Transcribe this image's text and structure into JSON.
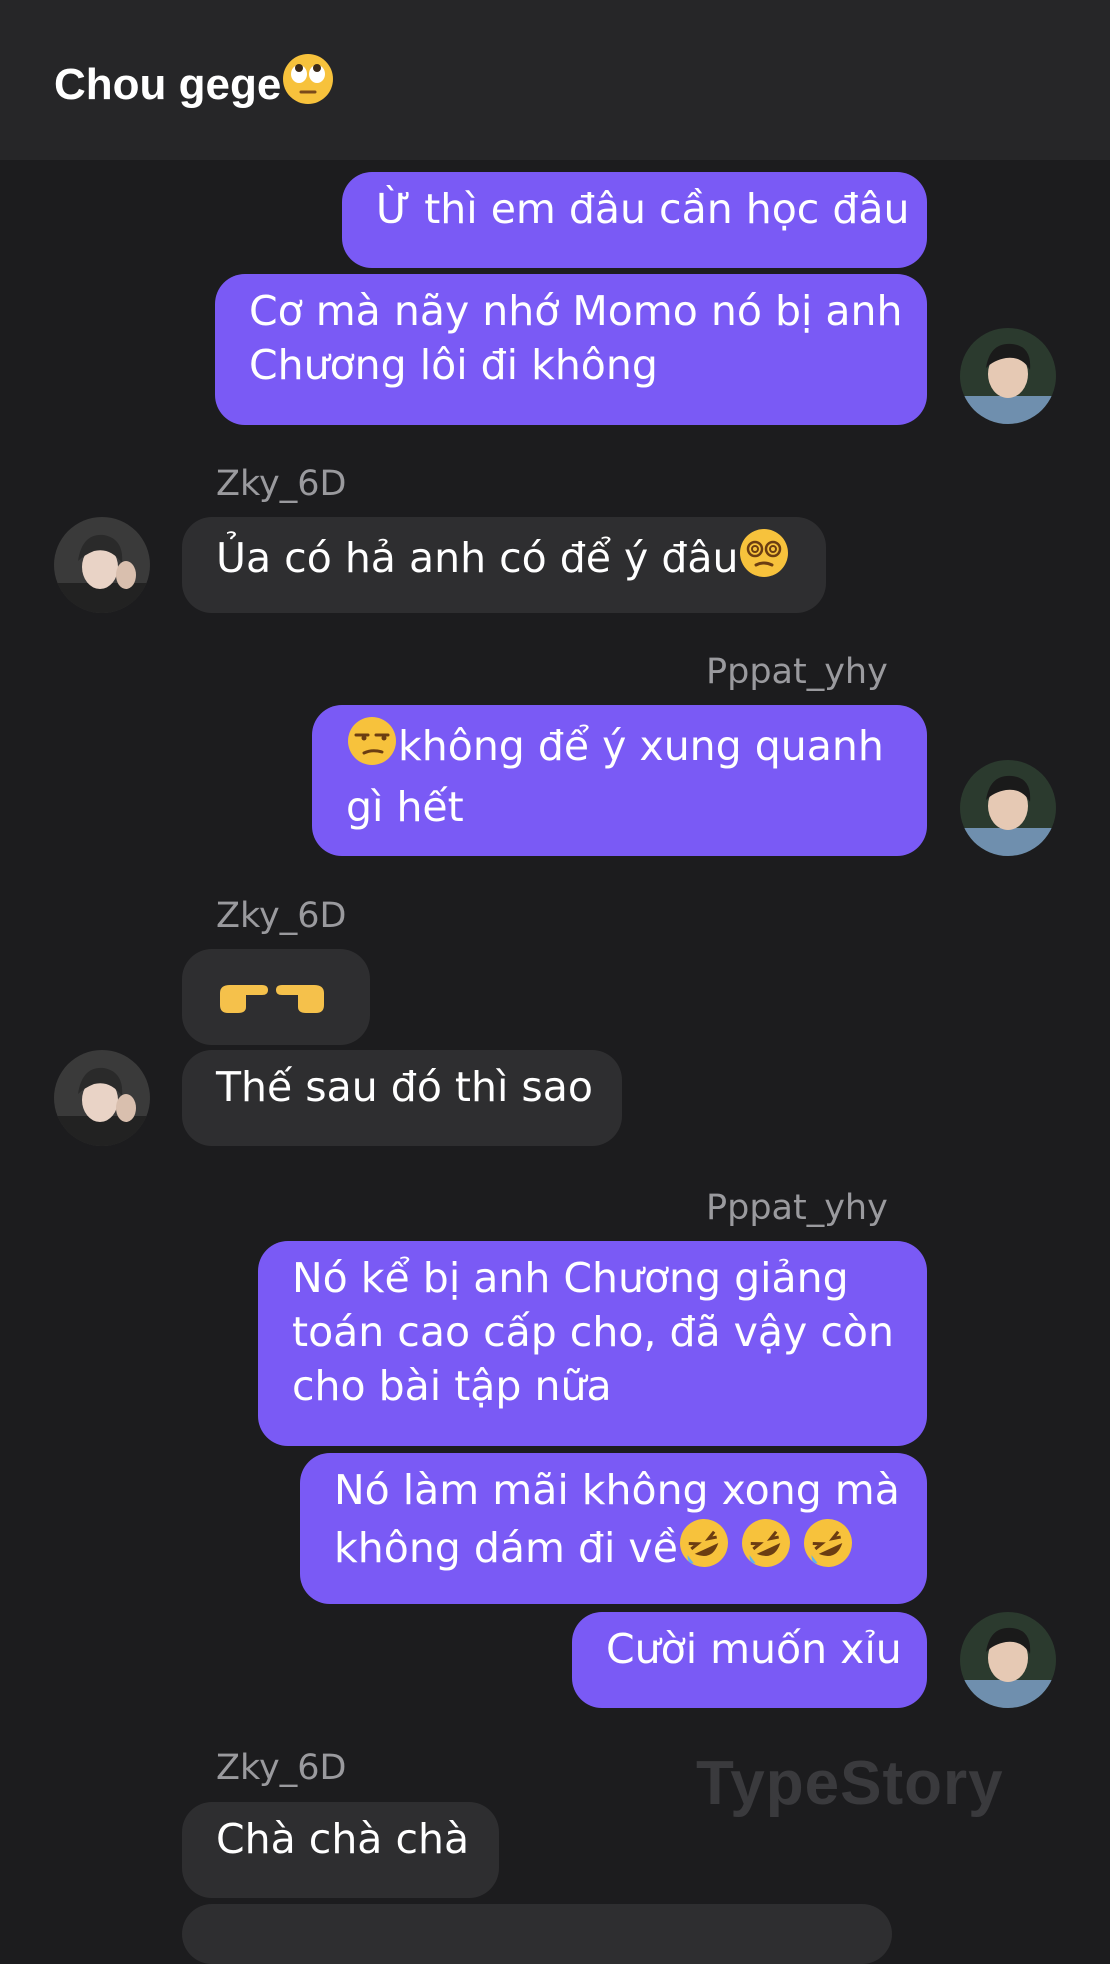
{
  "header": {
    "title": "Chou gege",
    "title_emoji": "eye-roll-emoji-icon"
  },
  "messages": [
    {
      "side": "out",
      "text": "Ừ thì em đâu cần học đâu"
    },
    {
      "side": "out",
      "lines": [
        "Cơ mà nãy nhớ Momo nó bị anh",
        "Chương lôi đi không"
      ]
    },
    {
      "side": "in",
      "sender": "Zky_6D",
      "text": "Ủa có hả anh có để ý đâu",
      "emoji": "dizzy-face-emoji-icon"
    },
    {
      "side": "out",
      "sender": "Pppat_yhy",
      "lines": [
        "không để ý xung quanh",
        "gì hết"
      ],
      "emoji": "unamused-face-emoji-icon"
    },
    {
      "side": "in",
      "sender": "Zky_6D",
      "emojis": [
        "pointing-right-emoji-icon",
        "pointing-left-emoji-icon"
      ]
    },
    {
      "side": "in",
      "text": "Thế sau đó thì sao"
    },
    {
      "side": "out",
      "sender": "Pppat_yhy",
      "lines": [
        "Nó kể bị anh Chương giảng",
        "toán cao cấp cho, đã vậy còn",
        "cho bài tập nữa"
      ]
    },
    {
      "side": "out",
      "lines": [
        "Nó làm mãi không xong mà",
        "không dám đi về"
      ],
      "emojis": [
        "rofl-emoji-icon",
        "rofl-emoji-icon",
        "rofl-emoji-icon"
      ]
    },
    {
      "side": "out",
      "text": "Cười muốn xỉu"
    },
    {
      "side": "in",
      "sender": "Zky_6D",
      "text": "Chà chà chà"
    }
  ],
  "watermark": "TypeStory",
  "colors": {
    "background": "#1c1c1e",
    "header": "#262628",
    "outgoing_bubble": "#7a5af5",
    "incoming_bubble": "#2e2e30",
    "sender_name": "#9a9a9e"
  }
}
